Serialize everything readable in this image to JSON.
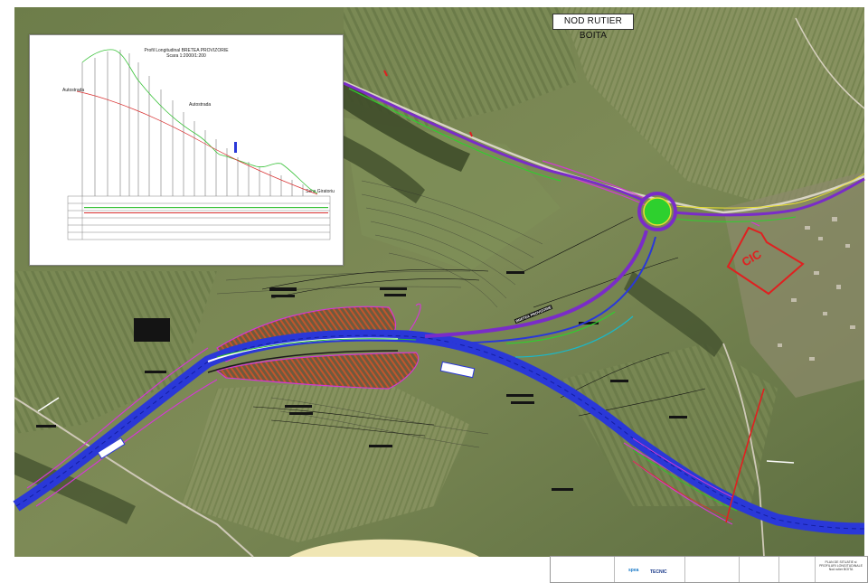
{
  "map": {
    "title": "NOD RUTIER BOITA",
    "zone_label": "CIC",
    "ramp_label": "BRETEA PROVIZORIE"
  },
  "inset": {
    "title_line1": "Profil Longitudinal BRETEA PROVIZORIE",
    "title_line2": "Scara 1:2000/1:200",
    "label_autostrada_left": "Autostrada",
    "label_autostrada_mid": "Autostrada",
    "label_sens": "Sens Giratoriu"
  },
  "legend": {
    "brand_left": "spea",
    "brand_right": "TECNIC",
    "sheet_title_1": "PLAN DE SITUATIE si",
    "sheet_title_2": "PROFILURI LONGITUDINALE",
    "sheet_title_3": "Nod rutier BOITA"
  },
  "colors": {
    "highway_blue": "#2a38d8",
    "ramp_purple": "#7a2cc8",
    "profile_green": "#3ac23a",
    "profile_red": "#d83030",
    "zone_red": "#e02020",
    "roundabout_green": "#2ed02e"
  }
}
